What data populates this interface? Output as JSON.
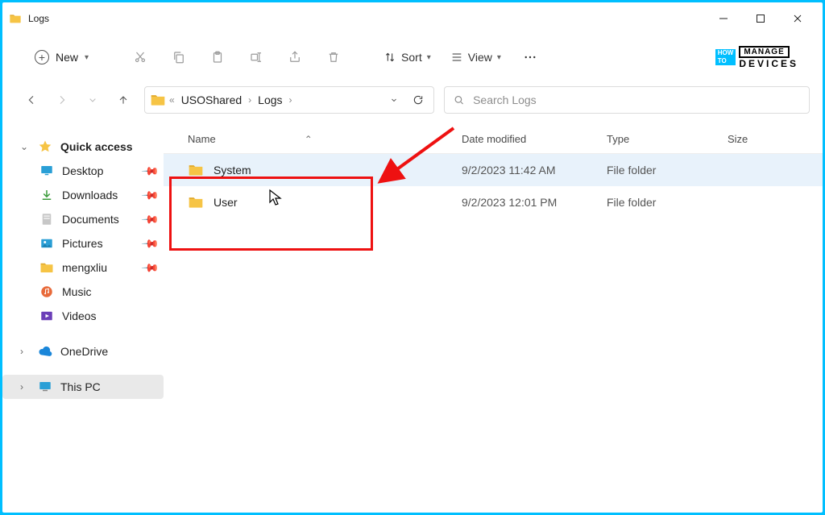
{
  "window": {
    "title": "Logs"
  },
  "toolbar": {
    "new_label": "New",
    "sort_label": "Sort",
    "view_label": "View"
  },
  "breadcrumb": {
    "parts": [
      "USOShared",
      "Logs"
    ]
  },
  "search": {
    "placeholder": "Search Logs"
  },
  "sidebar": {
    "quick_access": "Quick access",
    "items": [
      {
        "label": "Desktop"
      },
      {
        "label": "Downloads"
      },
      {
        "label": "Documents"
      },
      {
        "label": "Pictures"
      },
      {
        "label": "mengxliu"
      },
      {
        "label": "Music"
      },
      {
        "label": "Videos"
      }
    ],
    "onedrive": "OneDrive",
    "thispc": "This PC"
  },
  "columns": {
    "name": "Name",
    "date": "Date modified",
    "type": "Type",
    "size": "Size"
  },
  "rows": [
    {
      "name": "System",
      "date": "9/2/2023 11:42 AM",
      "type": "File folder",
      "size": ""
    },
    {
      "name": "User",
      "date": "9/2/2023 12:01 PM",
      "type": "File folder",
      "size": ""
    }
  ],
  "logo": {
    "how": "HOW",
    "to": "TO",
    "manage": "MANAGE",
    "devices": "DEVICES"
  }
}
